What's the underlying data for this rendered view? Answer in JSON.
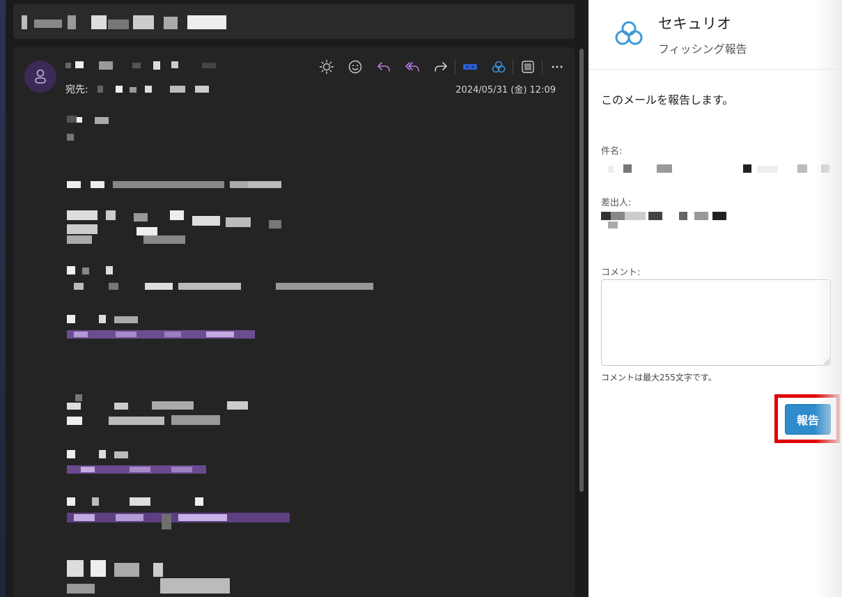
{
  "email": {
    "to_label": "宛先:",
    "date": "2024/05/31 (金) 12:09",
    "toolbar": [
      {
        "icon": "sun-icon",
        "color": "#cfcfcf"
      },
      {
        "icon": "emoji-icon",
        "color": "#cfcfcf"
      },
      {
        "icon": "reply-icon",
        "color": "#b77be0"
      },
      {
        "icon": "reply-all-icon",
        "color": "#b77be0"
      },
      {
        "icon": "forward-icon",
        "color": "#cfcfcf"
      },
      {
        "icon": "addin-icon",
        "color": "#2b5fd8"
      },
      {
        "icon": "securio-icon",
        "color": "#3d8fd6"
      },
      {
        "icon": "apps-icon",
        "color": "#cfcfcf"
      },
      {
        "icon": "more-icon",
        "color": "#cfcfcf"
      }
    ]
  },
  "panel": {
    "title": "セキュリオ",
    "subtitle": "フィッシング報告",
    "report_message": "このメールを報告します。",
    "subject_label": "件名:",
    "sender_label": "差出人:",
    "comment_label": "コメント:",
    "comment_value": "",
    "comment_hint": "コメントは最大255文字です。",
    "report_button": "報告"
  },
  "colors": {
    "accent": "#2e8bcc",
    "highlight": "#e00000",
    "link_purple": "#b77be0"
  }
}
